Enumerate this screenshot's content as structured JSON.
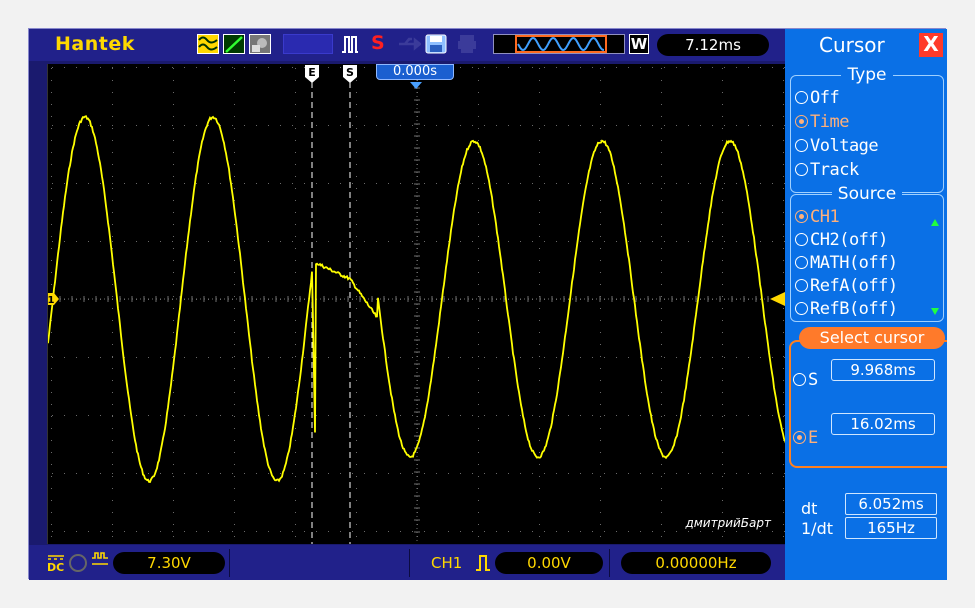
{
  "brand": "Hantek",
  "toolbar": {
    "icons": [
      "waveform-icon",
      "slope-icon",
      "snapshot-icon",
      "pulse-icon",
      "save-icon",
      "print-icon",
      "memory-depth-icon",
      "window-icon",
      "usb-icon"
    ],
    "save_label": "S",
    "window_label": "W",
    "timebase": "7.12ms"
  },
  "screen": {
    "trigger_position": "0.000s",
    "cursor_e_label": "E",
    "cursor_s_label": "S",
    "channel_marker": "1",
    "watermark": "дмитрийБарт",
    "trace_color": "#ffff00"
  },
  "bottom": {
    "coupling": "DC",
    "ch1_scale": "7.30V",
    "trigger_source": "CH1",
    "trigger_level": "0.00V",
    "frequency": "0.00000Hz"
  },
  "panel": {
    "title": "Cursor",
    "close_label": "X",
    "type_title": "Type",
    "type_options": [
      {
        "label": "Off",
        "selected": false
      },
      {
        "label": "Time",
        "selected": true
      },
      {
        "label": "Voltage",
        "selected": false
      },
      {
        "label": "Track",
        "selected": false
      }
    ],
    "source_title": "Source",
    "source_options": [
      {
        "label": "CH1",
        "selected": true
      },
      {
        "label": "CH2(off)",
        "selected": false
      },
      {
        "label": "MATH(off)",
        "selected": false
      },
      {
        "label": "RefA(off)",
        "selected": false
      },
      {
        "label": "RefB(off)",
        "selected": false
      }
    ],
    "select_cursor_title": "Select cursor",
    "cursor_s": {
      "label": "S",
      "value": "9.968ms"
    },
    "cursor_e": {
      "label": "E",
      "value": "16.02ms"
    },
    "dt_label": "dt",
    "dt_value": "6.052ms",
    "inv_dt_label": "1/dt",
    "inv_dt_value": "165Hz"
  },
  "colors": {
    "accent_orange": "#ff7a2a",
    "panel_blue": "#0a70e6",
    "trace_yellow": "#ffff00"
  }
}
